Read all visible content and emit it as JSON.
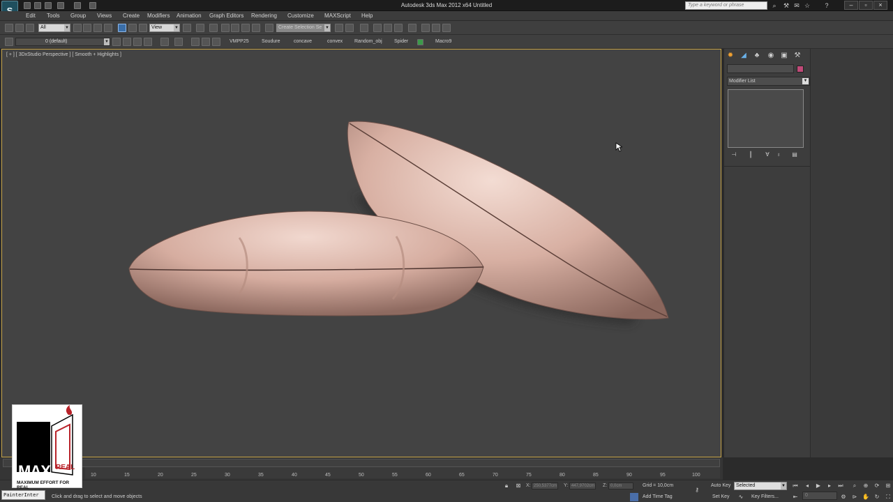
{
  "app": {
    "title": "Autodesk 3ds Max  2012 x64     Untitled",
    "logo_letter": "S",
    "search_placeholder": "Type a keyword or phrase"
  },
  "menu": [
    "Edit",
    "Tools",
    "Group",
    "Views",
    "Create",
    "Modifiers",
    "Animation",
    "Graph Editors",
    "Rendering",
    "Customize",
    "MAXScript",
    "Help"
  ],
  "toolbar": {
    "selection_filter": "All",
    "reference_coord": "View",
    "named_selection": "Create Selection Se",
    "layer": "0 (default)"
  },
  "macros": [
    "VMPP25",
    "Soudure",
    "concave",
    "convex",
    "Random_obj",
    "Spider",
    "Macro9"
  ],
  "viewport": {
    "label": "[ + ] [ 3DxStudio Perspective ] [ Smooth + Highlights ]",
    "pillow_color": "#d8b3a6"
  },
  "command_panel": {
    "modifier_list": "Modifier List",
    "color_swatch": "#c04a78"
  },
  "timeline": {
    "ticks": [
      "10",
      "15",
      "20",
      "25",
      "30",
      "35",
      "40",
      "45",
      "50",
      "55",
      "60",
      "65",
      "70",
      "75",
      "80",
      "85",
      "90",
      "95",
      "100"
    ]
  },
  "status": {
    "maxscript": "PainterInter",
    "prompt": "Click and drag to select and move objects",
    "x_label": "X:",
    "x_value": "250,5377cm",
    "y_label": "Y:",
    "y_value": "447,9702cm",
    "z_label": "Z:",
    "z_value": "0,0cm",
    "grid": "Grid = 10,0cm",
    "add_time_tag": "Add Time Tag",
    "auto_key": "Auto Key",
    "set_key": "Set Key",
    "key_mode": "Selected",
    "key_filters": "Key Filters...",
    "frame": "0"
  },
  "brand": {
    "word": "MAX",
    "word2": "REAL",
    "tagline": "MAXIMUM EFFORT FOR REAL"
  }
}
